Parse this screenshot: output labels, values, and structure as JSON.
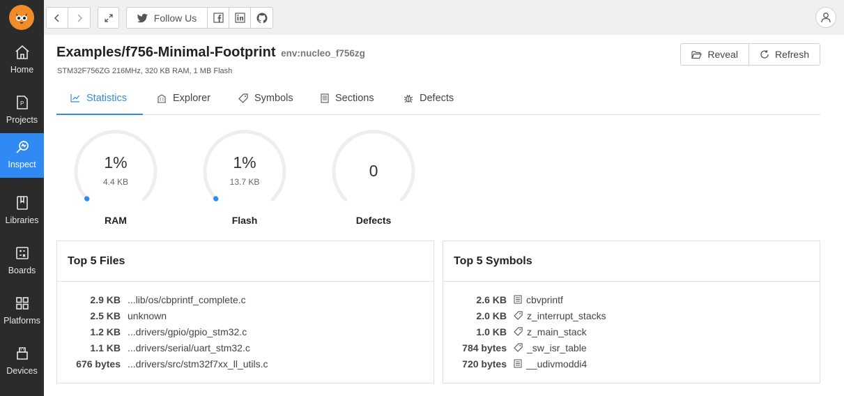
{
  "sidebar": {
    "items": [
      {
        "label": "Home",
        "icon": "home-icon"
      },
      {
        "label": "Projects",
        "icon": "projects-icon"
      },
      {
        "label": "Inspect",
        "icon": "inspect-icon",
        "active": true
      },
      {
        "label": "Libraries",
        "icon": "libraries-icon"
      },
      {
        "label": "Boards",
        "icon": "boards-icon"
      },
      {
        "label": "Platforms",
        "icon": "platforms-icon"
      },
      {
        "label": "Devices",
        "icon": "devices-icon"
      }
    ]
  },
  "topbar": {
    "follow_label": "Follow Us"
  },
  "header": {
    "title": "Examples/f756-Minimal-Footprint",
    "env": "env:nucleo_f756zg",
    "subtitle": "STM32F756ZG 216MHz, 320 KB RAM, 1 MB Flash",
    "reveal_label": "Reveal",
    "refresh_label": "Refresh"
  },
  "tabs": [
    {
      "label": "Statistics",
      "active": true
    },
    {
      "label": "Explorer"
    },
    {
      "label": "Symbols"
    },
    {
      "label": "Sections"
    },
    {
      "label": "Defects"
    }
  ],
  "gauges": [
    {
      "value": "1%",
      "sub": "4.4 KB",
      "label": "RAM",
      "fraction": 0.01
    },
    {
      "value": "1%",
      "sub": "13.7 KB",
      "label": "Flash",
      "fraction": 0.01
    },
    {
      "value": "0",
      "sub": "",
      "label": "Defects",
      "fraction": 0
    }
  ],
  "files": {
    "title": "Top 5 Files",
    "rows": [
      {
        "size": "2.9 KB",
        "name": "...lib/os/cbprintf_complete.c"
      },
      {
        "size": "2.5 KB",
        "name": "unknown"
      },
      {
        "size": "1.2 KB",
        "name": "...drivers/gpio/gpio_stm32.c"
      },
      {
        "size": "1.1 KB",
        "name": "...drivers/serial/uart_stm32.c"
      },
      {
        "size": "676 bytes",
        "name": "...drivers/src/stm32f7xx_ll_utils.c"
      }
    ]
  },
  "symbols": {
    "title": "Top 5 Symbols",
    "rows": [
      {
        "size": "2.6 KB",
        "name": "cbvprintf",
        "icon": "function-icon"
      },
      {
        "size": "2.0 KB",
        "name": "z_interrupt_stacks",
        "icon": "tag-icon"
      },
      {
        "size": "1.0 KB",
        "name": "z_main_stack",
        "icon": "tag-icon"
      },
      {
        "size": "784 bytes",
        "name": "_sw_isr_table",
        "icon": "tag-icon"
      },
      {
        "size": "720 bytes",
        "name": "__udivmoddi4",
        "icon": "function-icon"
      }
    ]
  },
  "colors": {
    "accent": "#2f8bf3",
    "sidebar": "#2b2b2b"
  }
}
